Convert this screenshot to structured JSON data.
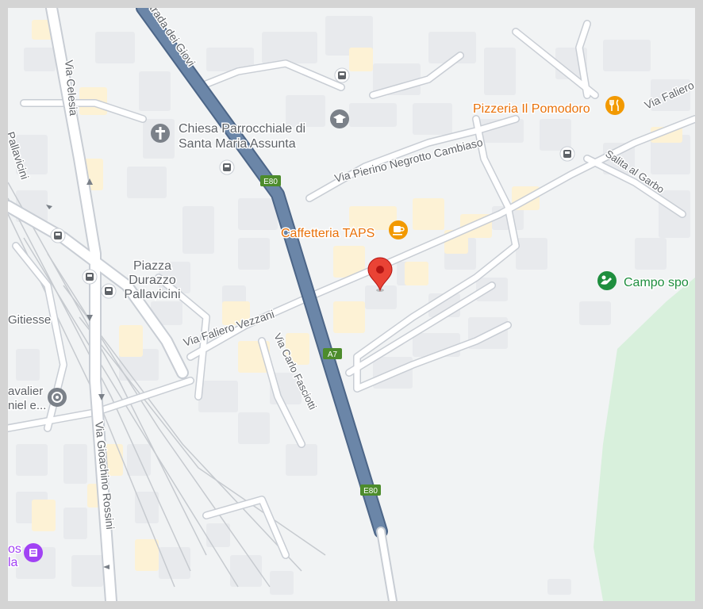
{
  "map": {
    "streets": {
      "strada_dei_giovi": "trada dei Giovi",
      "via_celesia": "Via Celesia",
      "pallavicini": "Pallavicini",
      "via_pierino_negrotto_cambiaso": "Via Pierino Negrotto Cambiaso",
      "salita_al_garbo": "Salita al Garbo",
      "via_faliero_vezzani": "Via Faliero Vezzani",
      "via_carlo_fasciotti": "Via Carlo Fasciotti",
      "via_gioachino_rossini": "Via Gioachino Rossini",
      "via_faliero_ne": "Via Faliero",
      "gitiesse": "Gitiesse"
    },
    "pois": {
      "chiesa_line1": "Chiesa Parrocchiale di",
      "chiesa_line2": "Santa Maria Assunta",
      "pizzeria": "Pizzeria Il Pomodoro",
      "caffetteria": "Caffetteria TAPS",
      "campo": "Campo spo",
      "piazza_line1": "Piazza",
      "piazza_line2": "Durazzo",
      "piazza_line3": "Pallavicini",
      "cavalier_line1": "avalier",
      "cavalier_line2": "niel e...",
      "bottom_left_line1": "os",
      "bottom_left_line2": "la"
    },
    "road_shields": [
      "E80",
      "A7",
      "E80"
    ],
    "colors": {
      "background": "#f1f3f4",
      "building": "#e8eaed",
      "building_yellow": "#fdf2d5",
      "street": "#ffffff",
      "street_outline": "#c8cdd4",
      "highway": "#6b86a8",
      "highway_outline": "#4c6587",
      "park": "#d8f0dc",
      "poi_orange": "#e8710a",
      "poi_gray": "#5f6368",
      "poi_green": "#1e8e3e",
      "poi_purple": "#a142f4",
      "pin_red": "#ea4335",
      "shield_green": "#4d8c2c"
    },
    "icons": [
      "church-icon",
      "school-icon",
      "bus-stop-icon",
      "restaurant-icon",
      "cafe-icon",
      "sports-icon",
      "pin-icon",
      "landmark-icon",
      "shopping-icon",
      "arrow-icon"
    ]
  }
}
